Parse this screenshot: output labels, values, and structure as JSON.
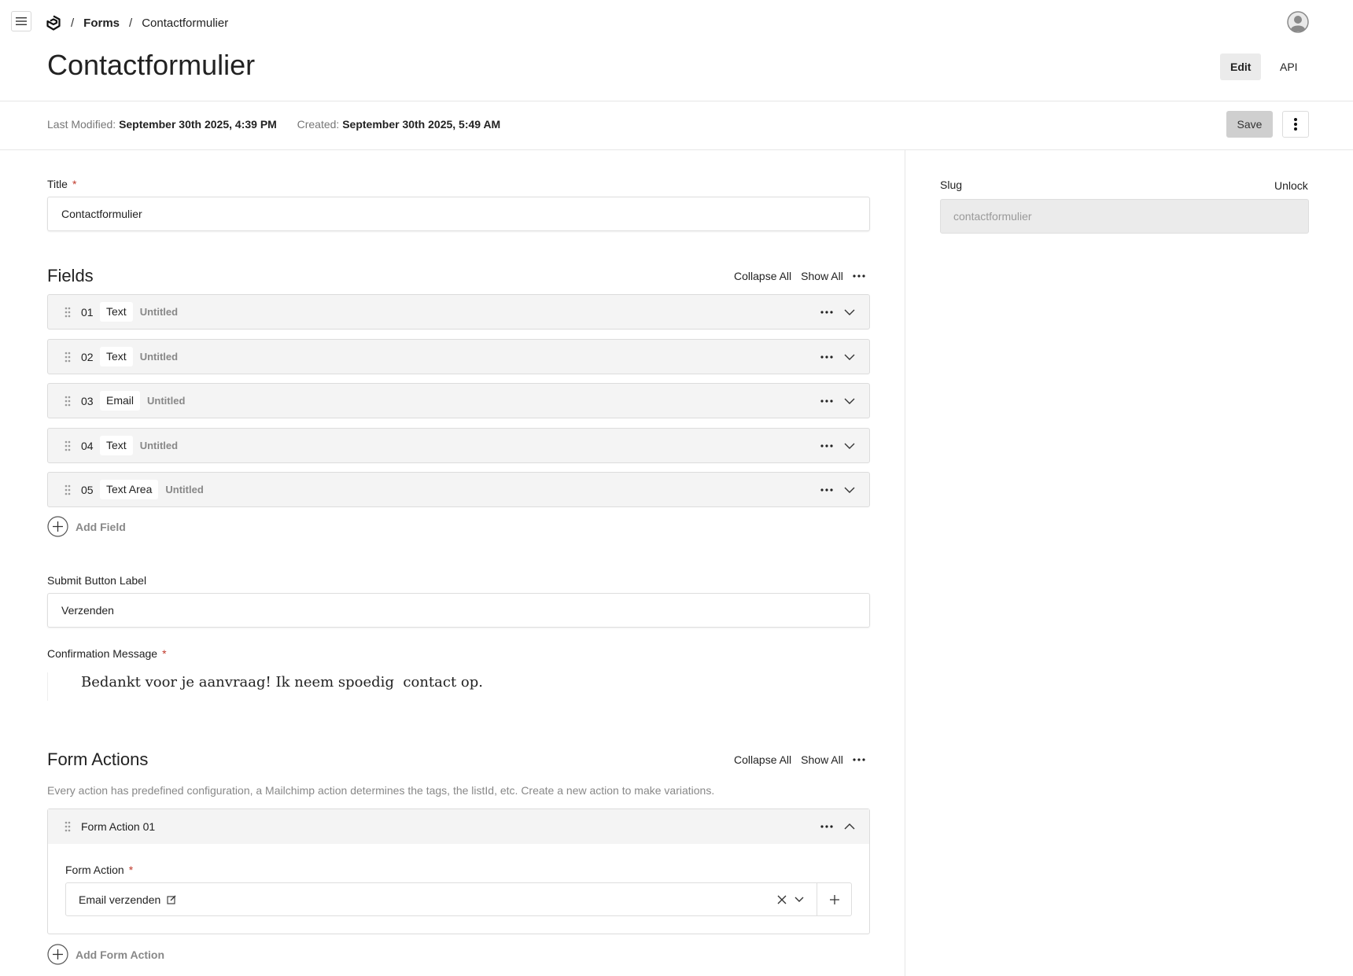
{
  "breadcrumb": {
    "section": "Forms",
    "current": "Contactformulier"
  },
  "header": {
    "title": "Contactformulier",
    "tabs": [
      {
        "label": "Edit",
        "active": true
      },
      {
        "label": "API",
        "active": false
      }
    ]
  },
  "meta": {
    "last_modified_label": "Last Modified:",
    "last_modified_value": "September 30th 2025, 4:39 PM",
    "created_label": "Created:",
    "created_value": "September 30th 2025, 5:49 AM",
    "save_label": "Save"
  },
  "title_field": {
    "label": "Title",
    "value": "Contactformulier"
  },
  "fields": {
    "heading": "Fields",
    "collapse_all": "Collapse All",
    "show_all": "Show All",
    "items": [
      {
        "num": "01",
        "type": "Text",
        "name": "Untitled"
      },
      {
        "num": "02",
        "type": "Text",
        "name": "Untitled"
      },
      {
        "num": "03",
        "type": "Email",
        "name": "Untitled"
      },
      {
        "num": "04",
        "type": "Text",
        "name": "Untitled"
      },
      {
        "num": "05",
        "type": "Text Area",
        "name": "Untitled"
      }
    ],
    "add_label": "Add Field"
  },
  "submit_button": {
    "label": "Submit Button Label",
    "value": "Verzenden"
  },
  "confirmation": {
    "label": "Confirmation Message",
    "value": "Bedankt voor je aanvraag! Ik neem spoedig  contact op."
  },
  "form_actions": {
    "heading": "Form Actions",
    "collapse_all": "Collapse All",
    "show_all": "Show All",
    "description": "Every action has predefined configuration, a Mailchimp action determines the tags, the listId, etc. Create a new action to make variations.",
    "item": {
      "title": "Form Action 01",
      "field_label": "Form Action",
      "value": "Email verzenden"
    },
    "add_label": "Add Form Action"
  },
  "slug": {
    "label": "Slug",
    "unlock": "Unlock",
    "value": "contactformulier"
  },
  "colors": {
    "required": "#c0392b",
    "save_bg": "#cfcfcf",
    "row_bg": "#f4f4f4"
  }
}
